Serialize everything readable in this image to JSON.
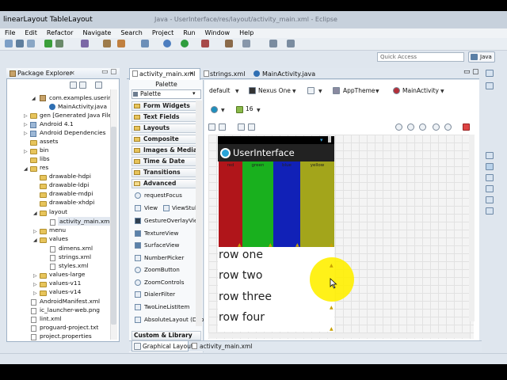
{
  "window": {
    "title_left": "linearLayout TableLayout",
    "title_right": "Java - UserInterface/res/layout/activity_main.xml - Eclipse"
  },
  "menubar": [
    "File",
    "Edit",
    "Refactor",
    "Navigate",
    "Search",
    "Project",
    "Run",
    "Window",
    "Help"
  ],
  "toolbar": {
    "quick_access_placeholder": "Quick Access",
    "perspective": "Java"
  },
  "package_explorer": {
    "title": "Package Explorer",
    "tree": [
      "com.examples.userinte",
      "MainActivity.java",
      "gen [Generated Java Files]",
      "Android 4.1",
      "Android Dependencies",
      "assets",
      "bin",
      "libs",
      "res",
      "drawable-hdpi",
      "drawable-ldpi",
      "drawable-mdpi",
      "drawable-xhdpi",
      "layout",
      "activity_main.xml",
      "menu",
      "values",
      "dimens.xml",
      "strings.xml",
      "styles.xml",
      "values-large",
      "values-v11",
      "values-v14",
      "AndroidManifest.xml",
      "ic_launcher-web.png",
      "lint.xml",
      "proguard-project.txt",
      "project.properties"
    ]
  },
  "editor": {
    "tabs": [
      "activity_main.xml",
      "strings.xml",
      "MainActivity.java"
    ],
    "bottom_tabs": [
      "Graphical Layout",
      "activity_main.xml"
    ],
    "combos": {
      "config": "default",
      "device": "Nexus One",
      "theme": "AppTheme",
      "activity": "MainActivity",
      "api": "16"
    }
  },
  "palette": {
    "title": "Palette",
    "dropdown": "Palette",
    "categories": [
      "Form Widgets",
      "Text Fields",
      "Layouts",
      "Composite",
      "Images & Media",
      "Time & Date",
      "Transitions",
      "Advanced"
    ],
    "items": [
      "requestFocus",
      "View",
      "ViewStub",
      "GestureOverlayView",
      "TextureView",
      "SurfaceView",
      "NumberPicker",
      "ZoomButton",
      "ZoomControls",
      "DialerFilter",
      "TwoLineListItem",
      "AbsoluteLayout (Depr"
    ],
    "bottom": "Custom & Library Views"
  },
  "preview": {
    "app_title": "UserInterface",
    "color_bars": [
      {
        "label": "red",
        "color": "#b0151a"
      },
      {
        "label": "green",
        "color": "#19b01e"
      },
      {
        "label": "blue",
        "color": "#1121b7"
      },
      {
        "label": "yellow",
        "color": "#a3a51b"
      }
    ],
    "rows": [
      "row one",
      "row two",
      "row three",
      "row four"
    ]
  },
  "colors": {
    "highlight": "#fff000",
    "action_bar": "#222222"
  }
}
